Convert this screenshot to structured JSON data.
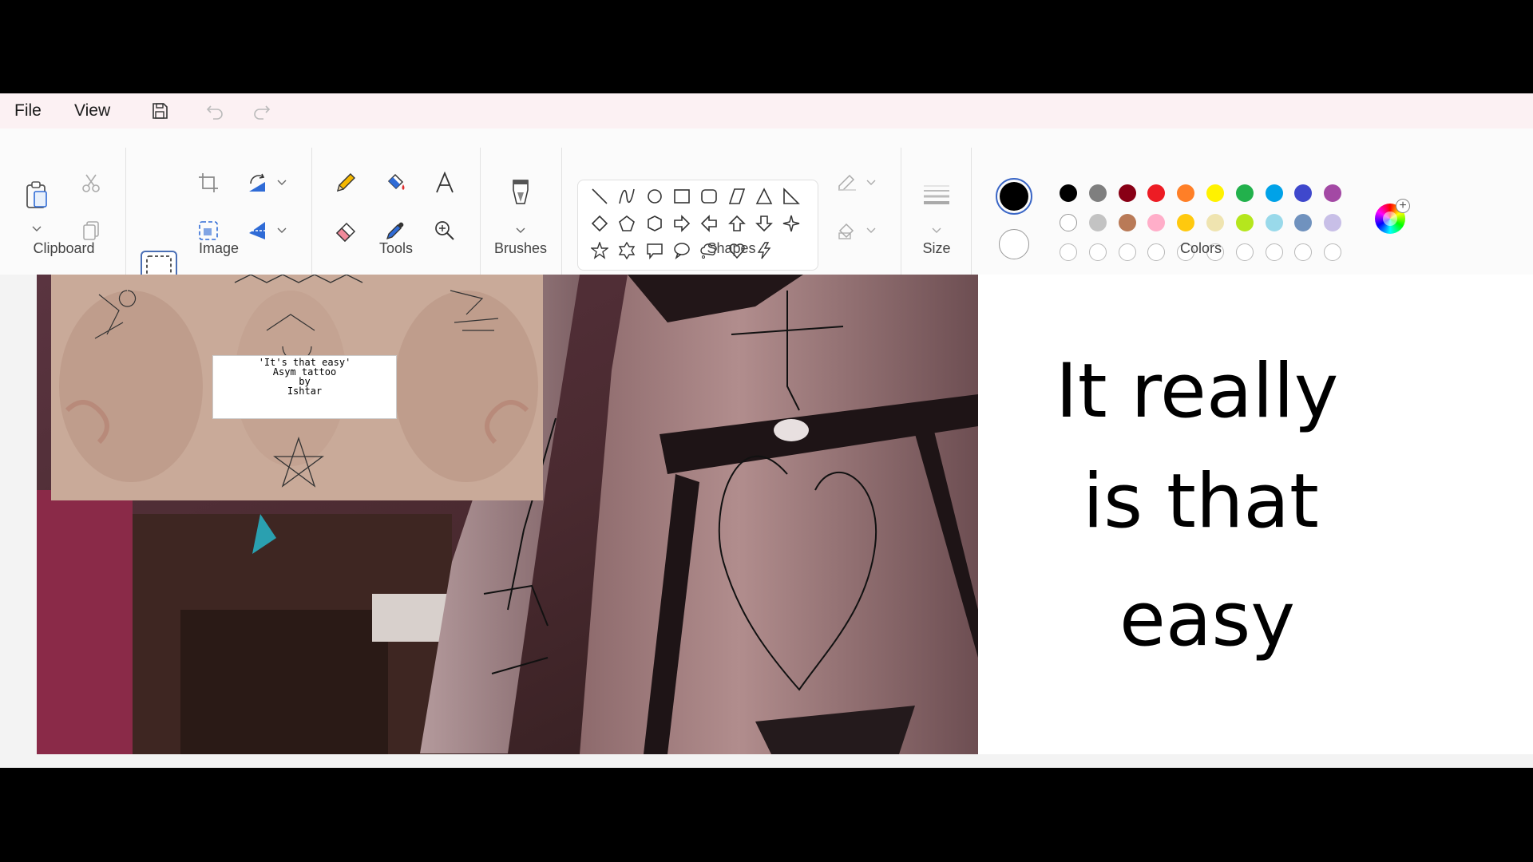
{
  "menu": {
    "file": "File",
    "view": "View"
  },
  "quick_access": {
    "save_icon": "save-icon",
    "undo_icon": "undo-icon",
    "redo_icon": "redo-icon"
  },
  "ribbon": {
    "groups": {
      "clipboard": "Clipboard",
      "image": "Image",
      "tools": "Tools",
      "brushes": "Brushes",
      "shapes": "Shapes",
      "size": "Size",
      "colors": "Colors"
    }
  },
  "colors": {
    "primary": "#000000",
    "secondary": "#ffffff",
    "palette_row1": [
      "#000000",
      "#7f7f7f",
      "#880015",
      "#ed1c24",
      "#ff7f27",
      "#fff200",
      "#22b14c",
      "#00a2e8",
      "#3f48cc",
      "#a349a4"
    ],
    "palette_row2": [
      "#ffffff",
      "#c3c3c3",
      "#b97a57",
      "#ffaec9",
      "#ffc90e",
      "#efe4b0",
      "#b5e61d",
      "#99d9ea",
      "#7092be",
      "#c8bfe7"
    ],
    "custom_slots": 10
  },
  "canvas": {
    "meme_text": [
      "It really",
      "is that",
      "easy"
    ],
    "tattoo_card": [
      "'It's that easy'",
      "Asym tattoo",
      "by",
      "Ishtar"
    ]
  }
}
